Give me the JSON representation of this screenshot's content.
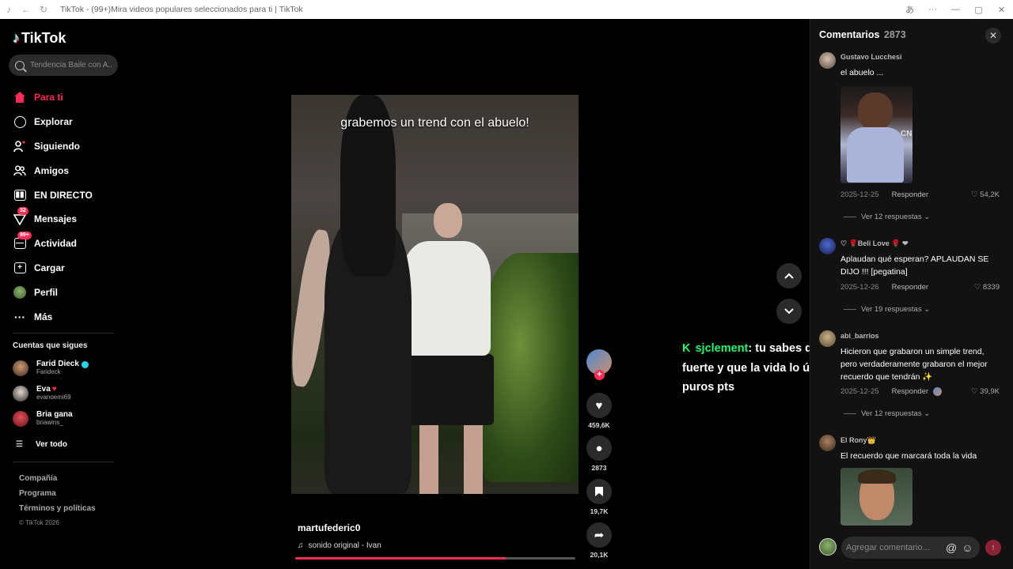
{
  "browser": {
    "title": "TikTok - (99+)Mira videos populares seleccionados para ti | TikTok"
  },
  "sidebar": {
    "logo": "TikTok",
    "search_placeholder": "Tendencia Baile con A...",
    "nav": [
      {
        "label": "Para ti",
        "icon": "home-icon",
        "active": true
      },
      {
        "label": "Explorar",
        "icon": "compass-icon"
      },
      {
        "label": "Siguiendo",
        "icon": "following-icon"
      },
      {
        "label": "Amigos",
        "icon": "friends-icon"
      },
      {
        "label": "EN DIRECTO",
        "icon": "live-icon"
      },
      {
        "label": "Mensajes",
        "icon": "messages-icon",
        "badge": "32"
      },
      {
        "label": "Actividad",
        "icon": "activity-icon",
        "badge": "99+"
      },
      {
        "label": "Cargar",
        "icon": "upload-icon"
      },
      {
        "label": "Perfil",
        "icon": "profile-avatar"
      },
      {
        "label": "Más",
        "icon": "more-icon"
      }
    ],
    "following_title": "Cuentas que sigues",
    "following": [
      {
        "name": "Farid Dieck",
        "handle": "Farideck",
        "verified": true
      },
      {
        "name": "Eva",
        "handle": "evanoemi69",
        "heart": true
      },
      {
        "name": "Bria gana",
        "handle": "briawins_"
      }
    ],
    "see_all": "Ver todo",
    "footer": [
      "Compañía",
      "Programa",
      "Términos y políticas"
    ],
    "copyright": "© TikTok 2026"
  },
  "video": {
    "caption": "grabemos un trend con el abuelo!",
    "author": "martufederic0",
    "sound": "sonido original - Ivan",
    "progress": 0.75
  },
  "actions": {
    "likes": "459,6K",
    "comments": "2873",
    "saves": "19,7K",
    "shares": "20,1K"
  },
  "overlay_comment": {
    "user": "sjclement",
    "text": ": tu sabes que es ser el más fuerte y que la vida lo único que te da es puros pts"
  },
  "comments_panel": {
    "title": "Comentarios",
    "count": "2873",
    "reply_label": "Responder",
    "input_placeholder": "Agregar comentario...",
    "comments": [
      {
        "user": "Gustavo Lucchesi",
        "text": "el abuelo ...",
        "date": "2025-12-25",
        "likes": "54,2K",
        "more": "Ver 12 respuestas"
      },
      {
        "user": "♡ 🌹Beli Love 🌹 ❤",
        "text": "Aplaudan qué esperan? APLAUDAN SE DIJO !!! [pegatina]",
        "date": "2025-12-26",
        "likes": "8339",
        "more": "Ver 19 respuestas"
      },
      {
        "user": "abi_barrios",
        "text": "Hicieron que grabaron un simple trend, pero verdaderamente grabaron el mejor recuerdo que tendrán ✨",
        "date": "2025-12-25",
        "likes": "39,9K",
        "more": "Ver 12 respuestas"
      },
      {
        "user": "El Rony👑",
        "text": "El recuerdo que marcará toda la vida"
      }
    ]
  },
  "colors": {
    "accent": "#fe2c55",
    "overlay_user": "#25f46e",
    "verified": "#20d5ec"
  }
}
